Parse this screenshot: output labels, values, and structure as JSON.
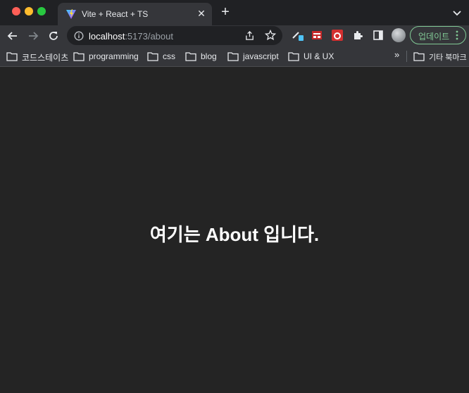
{
  "tab": {
    "title": "Vite + React + TS",
    "close_glyph": "✕",
    "favicon": "vite-icon"
  },
  "new_tab_glyph": "+",
  "omnibox": {
    "host": "localhost",
    "path": ":5173/about"
  },
  "toolbar": {
    "update_label": "업데이트"
  },
  "bookmarks": {
    "items": [
      {
        "label": "코드스테이츠"
      },
      {
        "label": "programming"
      },
      {
        "label": "css"
      },
      {
        "label": "blog"
      },
      {
        "label": "javascript"
      },
      {
        "label": "UI & UX"
      }
    ],
    "more_glyph": "»",
    "other_label": "기타 북마크"
  },
  "page": {
    "heading": "여기는 About 입니다."
  },
  "colors": {
    "page_background": "#242424",
    "tab_strip": "#202124",
    "toolbar": "#35363a",
    "update_accent": "#81c995",
    "traffic_red": "#ff5f57",
    "traffic_yellow": "#febc2e",
    "traffic_green": "#28c840"
  }
}
